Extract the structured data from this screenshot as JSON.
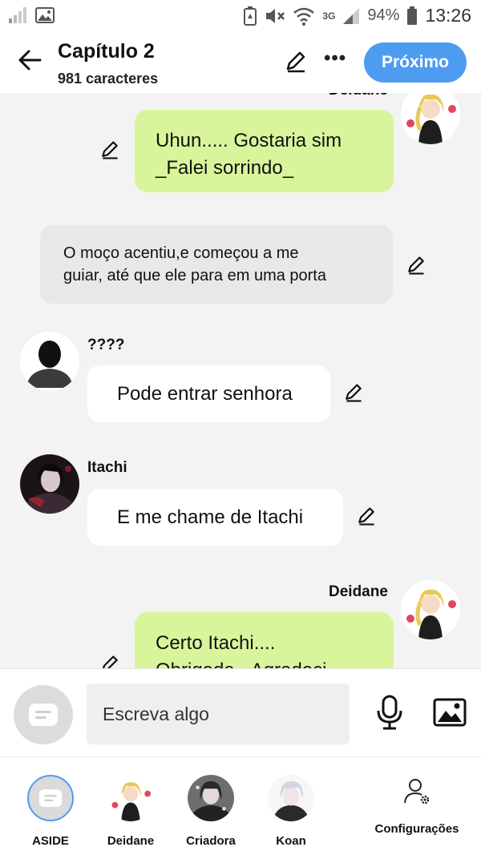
{
  "status_bar": {
    "network": "3G",
    "battery": "94%",
    "time": "13:26"
  },
  "header": {
    "title": "Capítulo 2",
    "subtitle": "981 caracteres",
    "next_label": "Próximo"
  },
  "messages": [
    {
      "type": "mine",
      "speaker": "Deidane",
      "text": "Uhun..... Gostaria sim\n_Falei sorrindo_"
    },
    {
      "type": "narration",
      "text": "O moço acentiu,e começou a me\nguiar, até que ele para em uma porta"
    },
    {
      "type": "other",
      "speaker": "????",
      "text": "Pode entrar senhora"
    },
    {
      "type": "other",
      "speaker": "Itachi",
      "text": "E me chame de Itachi"
    },
    {
      "type": "mine",
      "speaker": "Deidane",
      "text": "Certo Itachi....\nObrigada _Agradeci"
    }
  ],
  "composer": {
    "placeholder": "Escreva algo"
  },
  "cast": [
    {
      "label": "ASIDE"
    },
    {
      "label": "Deidane"
    },
    {
      "label": "Criadora"
    },
    {
      "label": "Koan"
    }
  ],
  "settings_label": "Configurações",
  "colors": {
    "accent": "#4e9cf0",
    "mine_bubble": "#d8f59c",
    "narration_bubble": "#e8e8e8",
    "other_bubble": "#ffffff"
  },
  "icons": [
    "signal-icon",
    "image-icon",
    "battery-saver-icon",
    "mute-icon",
    "wifi-icon",
    "back-arrow-icon",
    "pencil-icon",
    "more-icon",
    "aside-icon",
    "mic-icon",
    "gallery-icon",
    "settings-user-icon"
  ]
}
